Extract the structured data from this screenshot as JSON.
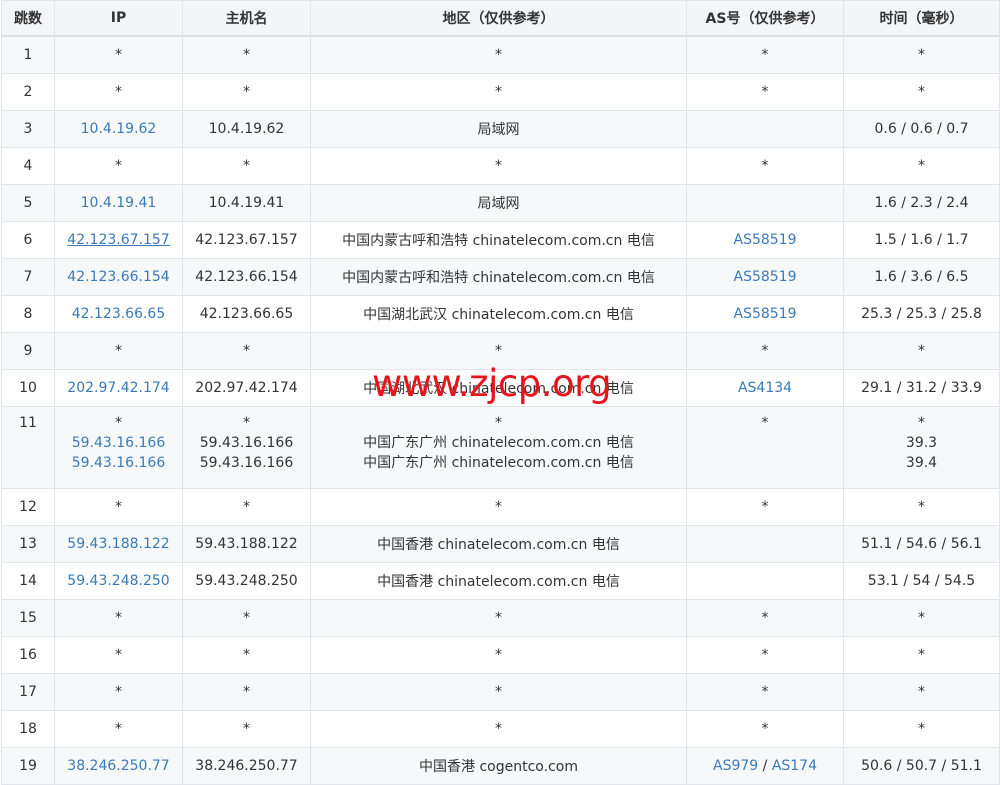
{
  "headers": [
    "跳数",
    "IP",
    "主机名",
    "地区（仅供参考）",
    "AS号（仅供参考）",
    "时间（毫秒）"
  ],
  "rows": [
    {
      "hop": "1",
      "ip": "*",
      "host": "*",
      "region": "*",
      "as": "*",
      "time": "*"
    },
    {
      "hop": "2",
      "ip": "*",
      "host": "*",
      "region": "*",
      "as": "*",
      "time": "*"
    },
    {
      "hop": "3",
      "ip": "10.4.19.62",
      "host": "10.4.19.62",
      "region": "局域网",
      "as": "",
      "time": "0.6 / 0.6 / 0.7"
    },
    {
      "hop": "4",
      "ip": "*",
      "host": "*",
      "region": "*",
      "as": "*",
      "time": "*"
    },
    {
      "hop": "5",
      "ip": "10.4.19.41",
      "host": "10.4.19.41",
      "region": "局域网",
      "as": "",
      "time": "1.6 / 2.3 / 2.4"
    },
    {
      "hop": "6",
      "ip": "42.123.67.157",
      "host": "42.123.67.157",
      "region": "中国内蒙古呼和浩特 chinatelecom.com.cn 电信",
      "as": "AS58519",
      "time": "1.5 / 1.6 / 1.7"
    },
    {
      "hop": "7",
      "ip": "42.123.66.154",
      "host": "42.123.66.154",
      "region": "中国内蒙古呼和浩特 chinatelecom.com.cn 电信",
      "as": "AS58519",
      "time": "1.6 / 3.6 / 6.5"
    },
    {
      "hop": "8",
      "ip": "42.123.66.65",
      "host": "42.123.66.65",
      "region": "中国湖北武汉 chinatelecom.com.cn 电信",
      "as": "AS58519",
      "time": "25.3 / 25.3 / 25.8"
    },
    {
      "hop": "9",
      "ip": "*",
      "host": "*",
      "region": "*",
      "as": "*",
      "time": "*"
    },
    {
      "hop": "10",
      "ip": "202.97.42.174",
      "host": "202.97.42.174",
      "region": "中国湖北武汉 chinatelecom.com.cn 电信",
      "as": "AS4134",
      "time": "29.1 / 31.2 / 33.9"
    },
    {
      "hop": "11",
      "ip": [
        "*",
        "59.43.16.166",
        "59.43.16.166"
      ],
      "host": [
        "*",
        "59.43.16.166",
        "59.43.16.166"
      ],
      "region": [
        "*",
        "中国广东广州 chinatelecom.com.cn 电信",
        "中国广东广州 chinatelecom.com.cn 电信"
      ],
      "as": "*",
      "time": [
        "*",
        "39.3",
        "39.4"
      ]
    },
    {
      "hop": "12",
      "ip": "*",
      "host": "*",
      "region": "*",
      "as": "*",
      "time": "*"
    },
    {
      "hop": "13",
      "ip": "59.43.188.122",
      "host": "59.43.188.122",
      "region": "中国香港 chinatelecom.com.cn 电信",
      "as": "",
      "time": "51.1 / 54.6 / 56.1"
    },
    {
      "hop": "14",
      "ip": "59.43.248.250",
      "host": "59.43.248.250",
      "region": "中国香港 chinatelecom.com.cn 电信",
      "as": "",
      "time": "53.1 / 54 / 54.5"
    },
    {
      "hop": "15",
      "ip": "*",
      "host": "*",
      "region": "*",
      "as": "*",
      "time": "*"
    },
    {
      "hop": "16",
      "ip": "*",
      "host": "*",
      "region": "*",
      "as": "*",
      "time": "*"
    },
    {
      "hop": "17",
      "ip": "*",
      "host": "*",
      "region": "*",
      "as": "*",
      "time": "*"
    },
    {
      "hop": "18",
      "ip": "*",
      "host": "*",
      "region": "*",
      "as": "*",
      "time": "*"
    },
    {
      "hop": "19",
      "ip": "38.246.250.77",
      "host": "38.246.250.77",
      "region": "中国香港 cogentco.com",
      "as": [
        "AS979",
        "AS174"
      ],
      "time": "50.6 / 50.7 / 51.1"
    }
  ],
  "as_separator": " / ",
  "watermark": "www.zjcp.org",
  "colors": {
    "link": "#3a7ab8",
    "header_bg": "#f4f5f7",
    "alt_row_bg": "#f7f8fa",
    "border": "#e1e4e8",
    "watermark": "#e8141c"
  }
}
